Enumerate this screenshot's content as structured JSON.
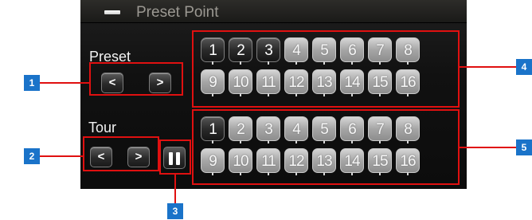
{
  "panel": {
    "title": "Preset Point"
  },
  "preset": {
    "label": "Preset",
    "prev_label": "<",
    "next_label": ">",
    "numbers": [
      "1",
      "2",
      "3",
      "4",
      "5",
      "6",
      "7",
      "8",
      "9",
      "10",
      "11",
      "12",
      "13",
      "14",
      "15",
      "16"
    ],
    "active_numbers": [
      "1",
      "2",
      "3"
    ]
  },
  "tour": {
    "label": "Tour",
    "prev_label": "<",
    "next_label": ">",
    "numbers": [
      "1",
      "2",
      "3",
      "4",
      "5",
      "6",
      "7",
      "8",
      "9",
      "10",
      "11",
      "12",
      "13",
      "14",
      "15",
      "16"
    ],
    "active_numbers": [
      "1"
    ]
  },
  "callouts": [
    "1",
    "2",
    "3",
    "4",
    "5"
  ],
  "colors": {
    "callout_red": "#e01010",
    "badge_blue": "#1a73c9",
    "panel_bg": "#111111",
    "title_gray": "#9b9892"
  }
}
